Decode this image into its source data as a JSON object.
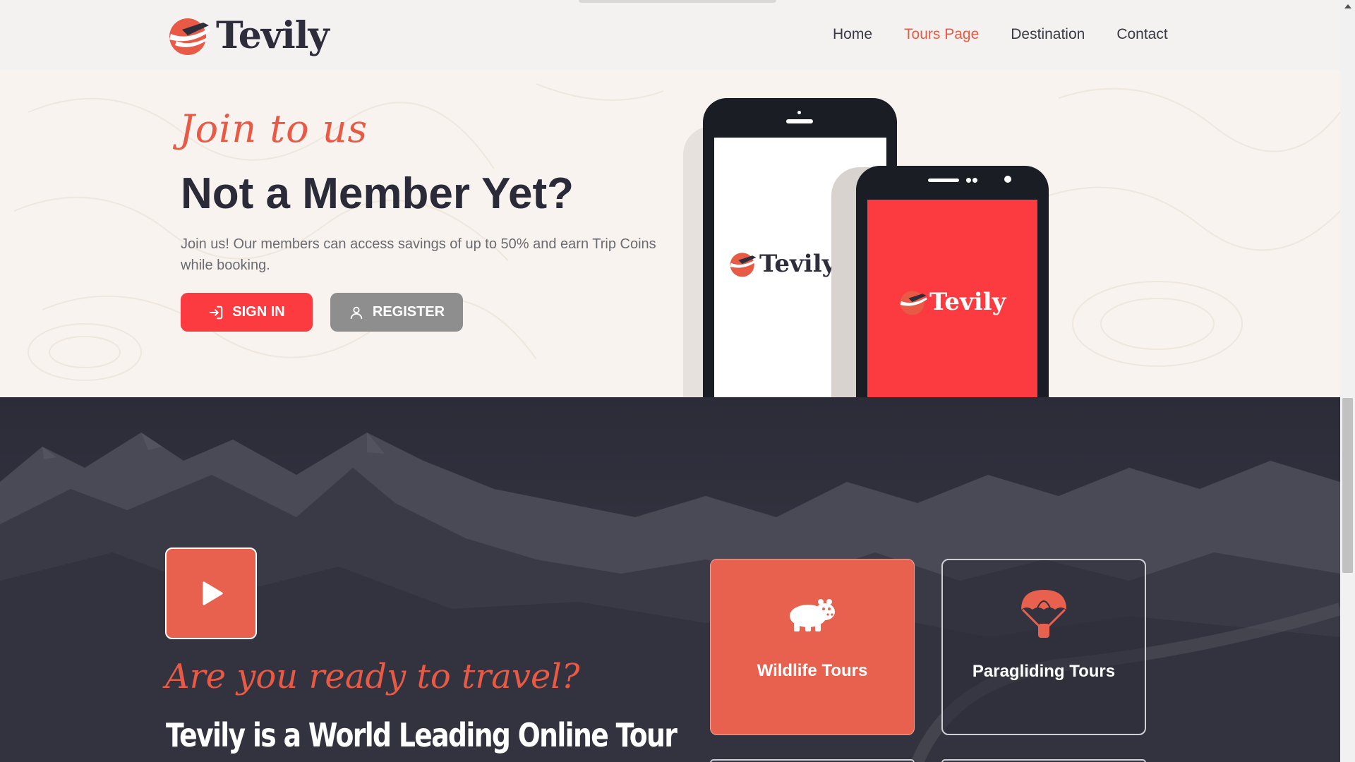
{
  "header": {
    "logo_text": "Tevily",
    "nav": [
      {
        "label": "Home",
        "active": false
      },
      {
        "label": "Tours Page",
        "active": true
      },
      {
        "label": "Destination",
        "active": false
      },
      {
        "label": "Contact",
        "active": false
      }
    ]
  },
  "join": {
    "script_heading": "Join to us",
    "title": "Not a Member Yet?",
    "description": "Join us! Our members can access savings of up to 50% and earn Trip Coins while booking.",
    "signin_label": "SIGN IN",
    "register_label": "REGISTER",
    "phone_logo_text": "Tevily"
  },
  "promo": {
    "script_heading": "Are you ready to travel?",
    "title": "Tevily is a World Leading Online Tour",
    "cards": [
      {
        "label": "Wildlife Tours",
        "icon": "hippo-icon"
      },
      {
        "label": "Paragliding Tours",
        "icon": "parachute-icon"
      }
    ]
  },
  "colors": {
    "accent": "#e85a45",
    "signin_bg": "#fb3b3f",
    "register_bg": "#8e8e8e",
    "dark_bg": "#2e2e3c",
    "title_dark": "#2b2a38"
  }
}
